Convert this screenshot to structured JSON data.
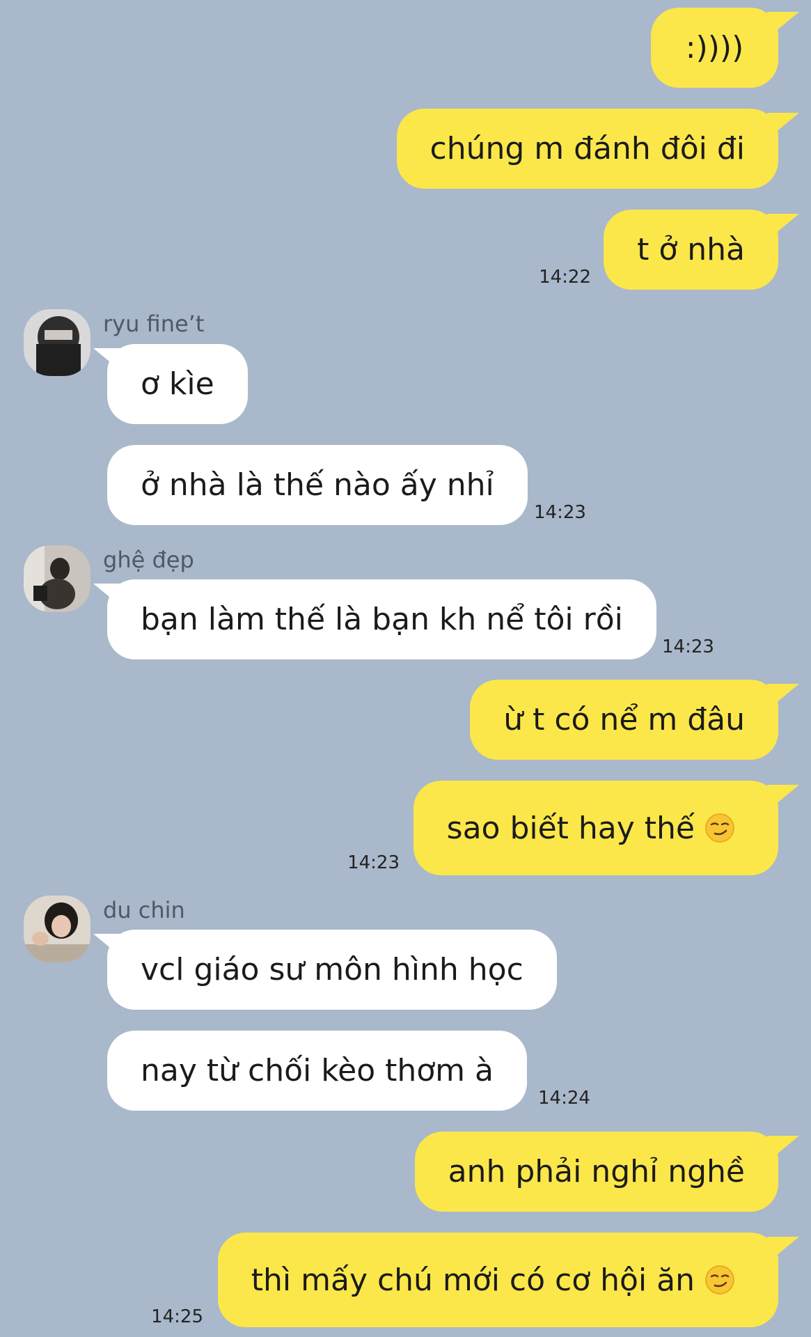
{
  "colors": {
    "background": "#a9b8cb",
    "outgoing_bubble": "#fbe74a",
    "incoming_bubble": "#ffffff"
  },
  "senders": {
    "s1": {
      "name": "ryu fine’t",
      "avatar": "avatar-photo-icon"
    },
    "s2": {
      "name": "ghệ đẹp",
      "avatar": "avatar-photo-icon"
    },
    "s3": {
      "name": "du chin",
      "avatar": "avatar-photo-icon"
    }
  },
  "messages": [
    {
      "direction": "out",
      "text": ":))))"
    },
    {
      "direction": "out",
      "text": "chúng m đánh đôi đi"
    },
    {
      "direction": "out",
      "text": "t ở nhà",
      "time": "14:22"
    },
    {
      "direction": "in",
      "sender": "s1",
      "text": "ơ kìe"
    },
    {
      "direction": "in",
      "sender": "s1",
      "text": "ở nhà là thế nào ấy nhỉ",
      "time": "14:23"
    },
    {
      "direction": "in",
      "sender": "s2",
      "text": "bạn làm thế là bạn kh nể tôi rồi",
      "time": "14:23"
    },
    {
      "direction": "out",
      "text": "ừ t có nể m đâu"
    },
    {
      "direction": "out",
      "text": "sao biết hay thế",
      "emoji": "smirk-emoji-icon",
      "time": "14:23"
    },
    {
      "direction": "in",
      "sender": "s3",
      "text": "vcl giáo sư môn hình học"
    },
    {
      "direction": "in",
      "sender": "s3",
      "text": "nay từ chối kèo thơm à",
      "time": "14:24"
    },
    {
      "direction": "out",
      "text": "anh phải nghỉ nghề"
    },
    {
      "direction": "out",
      "text": "thì mấy chú mới có cơ hội ăn",
      "emoji": "smirk-emoji-icon",
      "time": "14:25"
    }
  ]
}
